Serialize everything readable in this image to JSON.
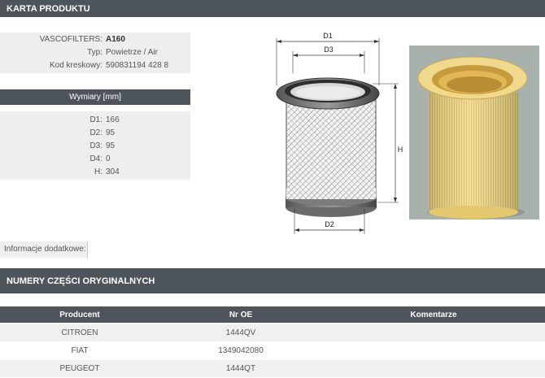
{
  "sections": {
    "product_card": "KARTA PRODUKTU",
    "original_numbers": "NUMERY CZĘŚCI ORYGINALNYCH"
  },
  "product": {
    "rows": [
      {
        "label": "VASCOFILTERS:",
        "value": "A160"
      },
      {
        "label": "Typ:",
        "value": "Powietrze / Air"
      },
      {
        "label": "Kod kreskowy:",
        "value": "590831194 428 8"
      }
    ]
  },
  "dimensions": {
    "header": "Wymiary [mm]",
    "rows": [
      {
        "label": "D1:",
        "value": "166"
      },
      {
        "label": "D2:",
        "value": "95"
      },
      {
        "label": "D3:",
        "value": "95"
      },
      {
        "label": "D4:",
        "value": "0"
      },
      {
        "label": "H:",
        "value": "304"
      }
    ]
  },
  "extra": {
    "label": "Informacje dodatkowe:"
  },
  "diagram": {
    "labels": {
      "d1": "D1",
      "d2": "D2",
      "d3": "D3",
      "h": "H"
    }
  },
  "table": {
    "headers": [
      "Producent",
      "Nr OE",
      "Komentarze"
    ],
    "rows": [
      [
        "CITROEN",
        "1444QV",
        ""
      ],
      [
        "FIAT",
        "1349042080",
        ""
      ],
      [
        "PEUGEOT",
        "1444QT",
        ""
      ]
    ]
  },
  "colors": {
    "header_bg": "#4d545b",
    "row_alt": "#f0f0f0",
    "filter_yellow": "#f3dc8a"
  }
}
